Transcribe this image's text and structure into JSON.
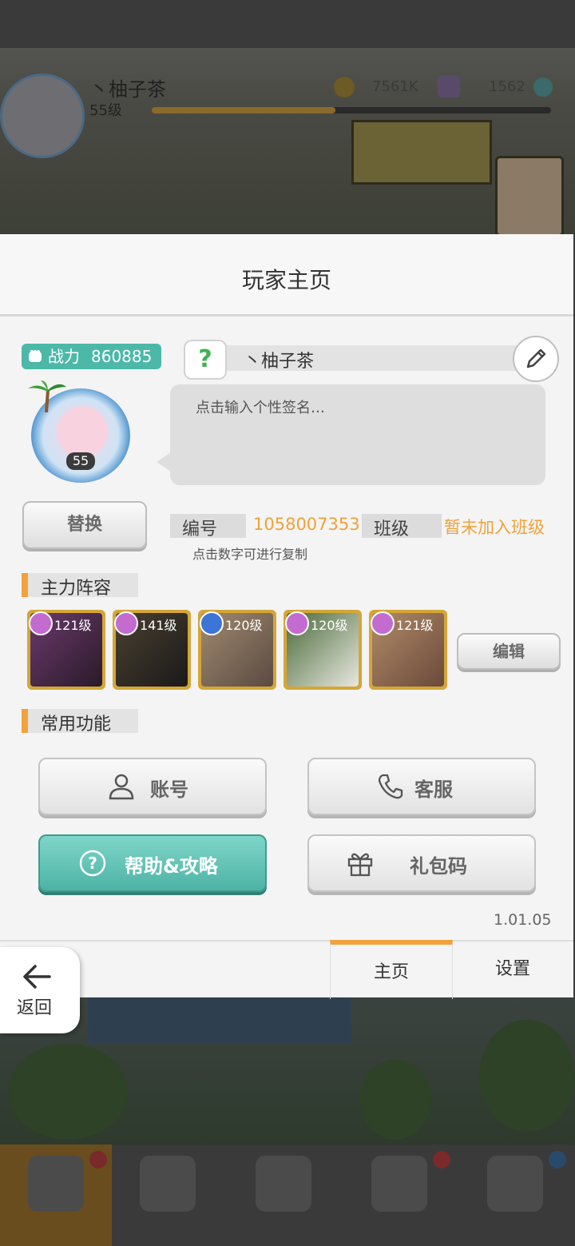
{
  "background": {
    "player_name": "丶柚子茶",
    "player_level": "55级",
    "coins": "7561K",
    "gems": "1562"
  },
  "panel": {
    "title": "玩家主页",
    "power_label": "战力",
    "power_value": "860885",
    "player_name": "丶柚子茶",
    "question_mark": "?",
    "signature_placeholder": "点击输入个性签名…",
    "avatar_level": "55",
    "replace_label": "替换",
    "id_label": "编号",
    "id_value": "1058007353",
    "class_label": "班级",
    "class_value": "暂未加入班级",
    "copy_hint": "点击数字可进行复制"
  },
  "team": {
    "title": "主力阵容",
    "heroes": [
      {
        "level": "121级",
        "element": "heart",
        "color": "#c46bd0"
      },
      {
        "level": "141级",
        "element": "heart",
        "color": "#c46bd0"
      },
      {
        "level": "120级",
        "element": "diamond",
        "color": "#3d74d8"
      },
      {
        "level": "120级",
        "element": "heart",
        "color": "#c46bd0"
      },
      {
        "level": "121级",
        "element": "heart",
        "color": "#c46bd0"
      }
    ],
    "edit_label": "编辑"
  },
  "functions": {
    "title": "常用功能",
    "account": "账号",
    "service": "客服",
    "help": "帮助&攻略",
    "gift_code": "礼包码"
  },
  "version": "1.01.05",
  "tabs": {
    "home": "主页",
    "settings": "设置"
  },
  "back_label": "返回",
  "colors": {
    "accent_orange": "#f1a23a",
    "teal": "#4db3a5"
  }
}
